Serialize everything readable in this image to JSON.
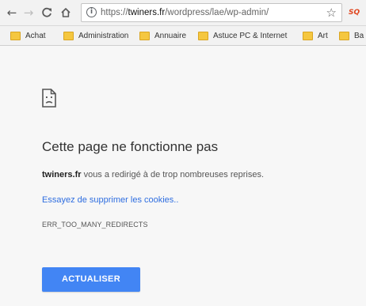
{
  "toolbar": {
    "back_icon": "back-arrow-icon",
    "forward_icon": "forward-arrow-icon",
    "reload_icon": "reload-icon",
    "home_icon": "home-icon",
    "url_scheme": "https://",
    "url_host": "twiners.fr",
    "url_path": "/wordpress/lae/wp-admin/",
    "star_icon": "star-icon",
    "extension_label": "SQ"
  },
  "bookmarks": [
    {
      "label": "Achat"
    },
    {
      "label": "Administration"
    },
    {
      "label": "Annuaire"
    },
    {
      "label": "Astuce PC & Internet"
    },
    {
      "label": "Art"
    },
    {
      "label": "Ba"
    }
  ],
  "error_page": {
    "icon": "sad-page-icon",
    "heading": "Cette page ne fonctionne pas",
    "message_domain": "twiners.fr",
    "message_rest": " vous a redirigé à de trop nombreuses reprises.",
    "link": "Essayez de supprimer les cookies..",
    "error_code": "ERR_TOO_MANY_REDIRECTS",
    "button": "ACTUALISER"
  },
  "colors": {
    "accent": "#4285f4",
    "link": "#2f6ee0",
    "folder": "#f5c740"
  }
}
